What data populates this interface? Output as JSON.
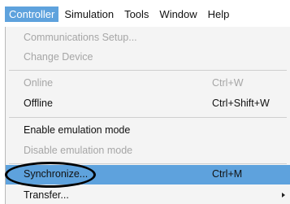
{
  "menubar": {
    "items": [
      {
        "label": "Controller"
      },
      {
        "label": "Simulation"
      },
      {
        "label": "Tools"
      },
      {
        "label": "Window"
      },
      {
        "label": "Help"
      }
    ]
  },
  "menu": {
    "items": [
      {
        "label": "Communications Setup...",
        "shortcut": "",
        "enabled": false
      },
      {
        "label": "Change Device",
        "shortcut": "",
        "enabled": false
      },
      {
        "label": "Online",
        "shortcut": "Ctrl+W",
        "enabled": false
      },
      {
        "label": "Offline",
        "shortcut": "Ctrl+Shift+W",
        "enabled": true
      },
      {
        "label": "Enable emulation mode",
        "shortcut": "",
        "enabled": true
      },
      {
        "label": "Disable emulation mode",
        "shortcut": "",
        "enabled": false
      },
      {
        "label": "Synchronize...",
        "shortcut": "Ctrl+M",
        "enabled": true,
        "highlighted": true
      },
      {
        "label": "Transfer...",
        "shortcut": "",
        "enabled": true,
        "submenu": true
      }
    ]
  },
  "colors": {
    "highlight": "#5ea2dd",
    "disabled_text": "#a6a6a6",
    "menu_background": "#f4f4f4"
  }
}
